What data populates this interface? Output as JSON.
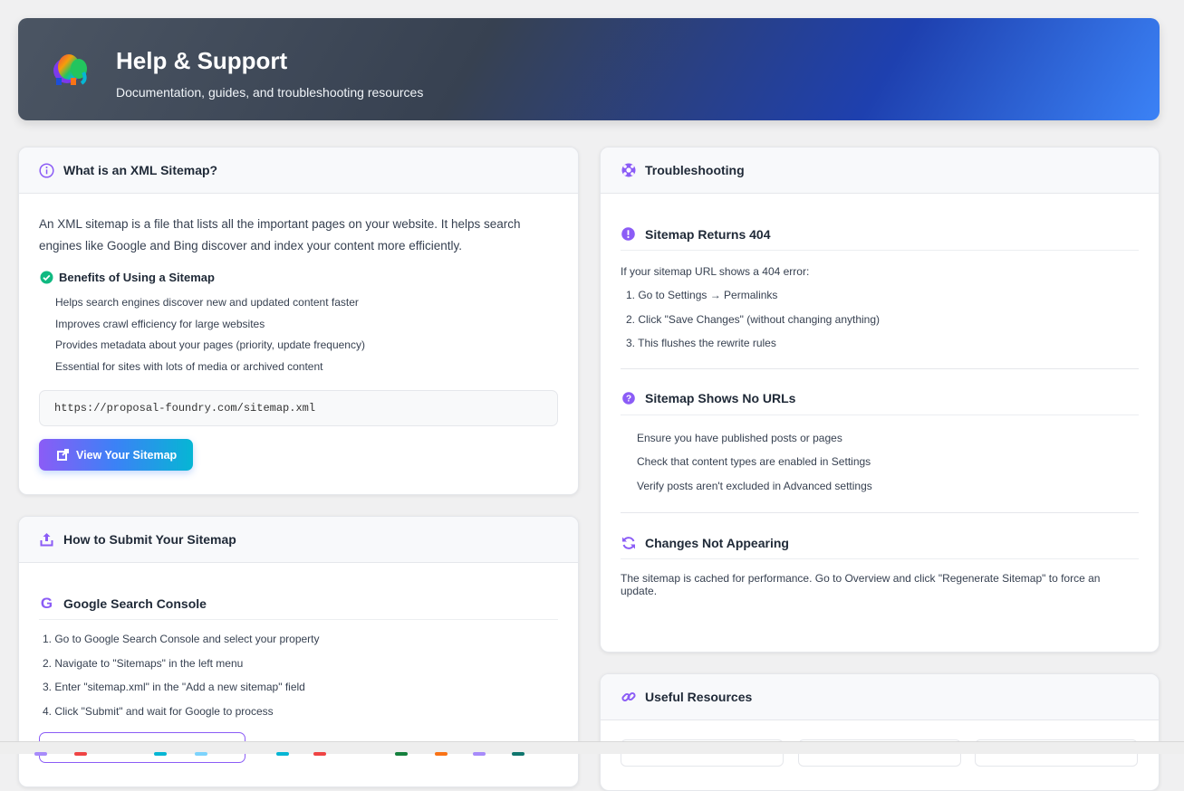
{
  "header": {
    "title": "Help & Support",
    "subtitle": "Documentation, guides, and troubleshooting resources"
  },
  "what": {
    "title": "What is an XML Sitemap?",
    "intro": "An XML sitemap is a file that lists all the important pages on your website. It helps search engines like Google and Bing discover and index your content more efficiently.",
    "benefits_title": "Benefits of Using a Sitemap",
    "benefits": [
      "Helps search engines discover new and updated content faster",
      "Improves crawl efficiency for large websites",
      "Provides metadata about your pages (priority, update frequency)",
      "Essential for sites with lots of media or archived content"
    ],
    "url": "https://proposal-foundry.com/sitemap.xml",
    "button": "View Your Sitemap"
  },
  "submit": {
    "title": "How to Submit Your Sitemap",
    "google_title": "Google Search Console",
    "steps": [
      "1. Go to Google Search Console and select your property",
      "2. Navigate to \"Sitemaps\" in the left menu",
      "3. Enter \"sitemap.xml\" in the \"Add a new sitemap\" field",
      "4. Click \"Submit\" and wait for Google to process"
    ]
  },
  "trouble": {
    "title": "Troubleshooting",
    "s404": {
      "title": "Sitemap Returns 404",
      "intro": "If your sitemap URL shows a 404 error:",
      "steps": [
        "1. Go to Settings → Permalinks",
        "2. Click \"Save Changes\" (without changing anything)",
        "3. This flushes the rewrite rules"
      ]
    },
    "nourls": {
      "title": "Sitemap Shows No URLs",
      "items": [
        "Ensure you have published posts or pages",
        "Check that content types are enabled in Settings",
        "Verify posts aren't excluded in Advanced settings"
      ]
    },
    "changes": {
      "title": "Changes Not Appearing",
      "text": "The sitemap is cached for performance. Go to Overview and click \"Regenerate Sitemap\" to force an update."
    }
  },
  "resources": {
    "title": "Useful Resources"
  },
  "colors": {
    "accent": "#8b5cf6",
    "success": "#10b981"
  }
}
